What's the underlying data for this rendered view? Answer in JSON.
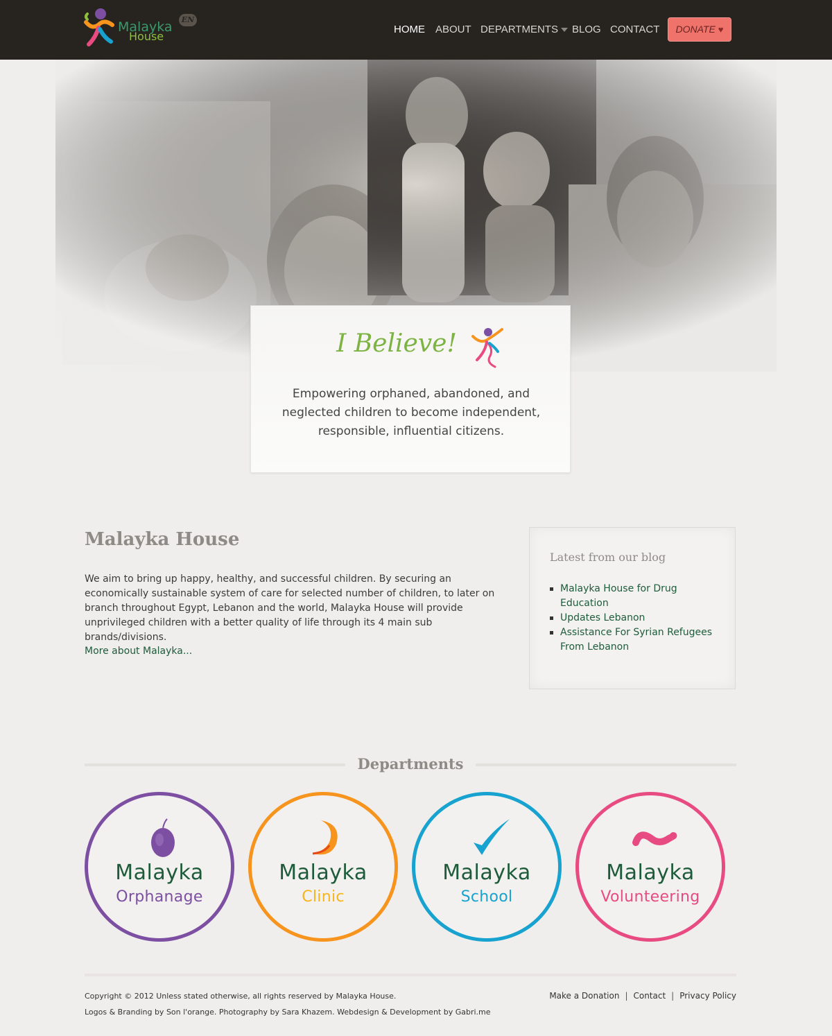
{
  "header": {
    "logo": {
      "line1": "Malayka",
      "line2": "House",
      "lang": "EN"
    },
    "nav": [
      {
        "label": "HOME",
        "active": true
      },
      {
        "label": "ABOUT"
      },
      {
        "label": "DEPARTMENTS",
        "has_dropdown": true
      },
      {
        "label": "BLOG"
      },
      {
        "label": "CONTACT"
      }
    ],
    "donate_label": "DONATE",
    "donate_icon": "heart-icon",
    "bar_color": "#27231f"
  },
  "hero": {
    "title": "I Believe!",
    "tagline": "Empowering orphaned, abandoned, and neglected children to become independent, responsible, influential citizens.",
    "title_color": "#7cb342"
  },
  "about": {
    "title": "Malayka House",
    "text": "We aim to bring up happy, healthy, and successful children. By securing an economically sustainable system of care for selected number of children, to later on branch throughout Egypt, Lebanon and the world, Malayka House will provide unprivileged children with a better quality of life through its 4 main sub brands/divisions.",
    "more_link": "More about Malayka..."
  },
  "blog": {
    "title": "Latest from our blog",
    "items": [
      "Malayka House for Drug Education",
      "Updates Lebanon",
      "Assistance For Syrian Refugees From Lebanon"
    ]
  },
  "departments": {
    "heading": "Departments",
    "items": [
      {
        "line1": "Malayka",
        "line2": "Orphanage",
        "color": "#7d4fa2",
        "icon": "fruit-icon"
      },
      {
        "line1": "Malayka",
        "line2": "Clinic",
        "color": "#f7941d",
        "icon": "crescent-icon"
      },
      {
        "line1": "Malayka",
        "line2": "School",
        "color": "#17a2d0",
        "icon": "checkmark-icon"
      },
      {
        "line1": "Malayka",
        "line2": "Volunteering",
        "color": "#e84a82",
        "icon": "brush-stroke-icon"
      }
    ]
  },
  "footer": {
    "copyright": "Copyright © 2012 Unless stated otherwise, all rights reserved by Malayka House.",
    "credits": "Logos & Branding by Son l'orange. Photography by Sara Khazem. Webdesign & Development by Gabri.me",
    "links": [
      "Make a Donation",
      "Contact",
      "Privacy Policy"
    ]
  }
}
